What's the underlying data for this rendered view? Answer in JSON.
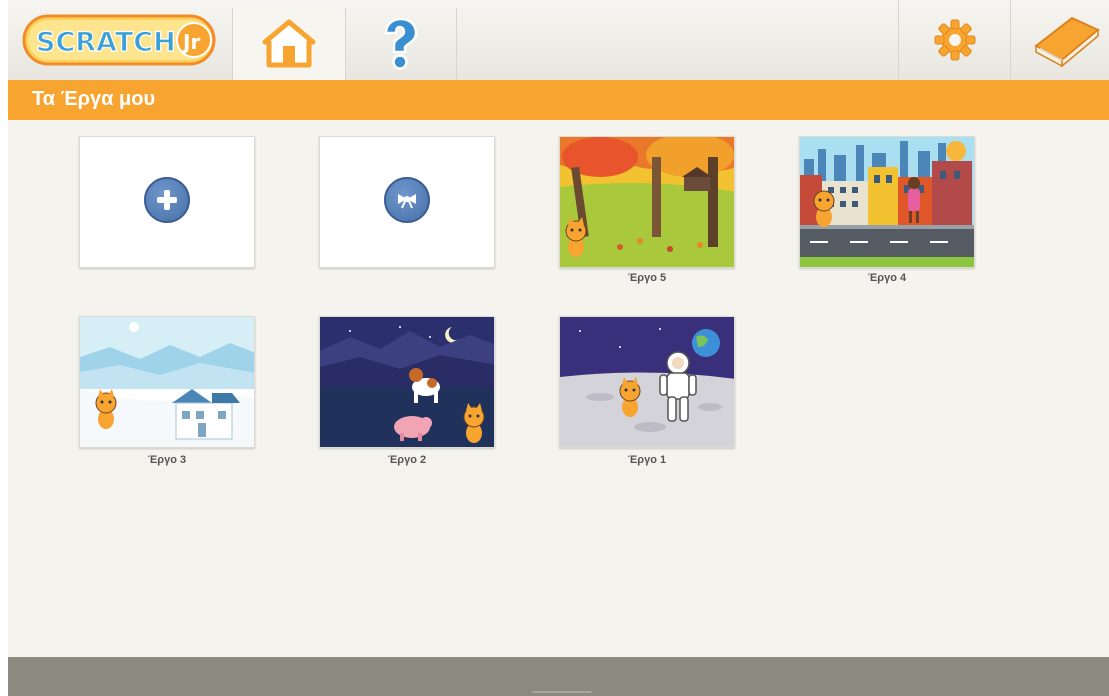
{
  "app": {
    "logo_text": "ScratchJr",
    "header_title": "Τα Έργα μου"
  },
  "toolbar": {
    "home_icon": "house-icon",
    "help_icon": "question-icon",
    "settings_icon": "gear-icon",
    "book_icon": "book-icon"
  },
  "colors": {
    "accent_orange": "#f7a431",
    "bottom_bar": "#8c8a7e",
    "button_blue": "#4f79b3"
  },
  "actions": {
    "new_project_icon": "plus-icon",
    "sample_projects_icon": "bow-icon"
  },
  "projects": [
    {
      "name": "Έργο 5",
      "scene": "autumn-park"
    },
    {
      "name": "Έργο 4",
      "scene": "city-street"
    },
    {
      "name": "Έργο 3",
      "scene": "winter-house"
    },
    {
      "name": "Έργο 2",
      "scene": "night-farm"
    },
    {
      "name": "Έργο 1",
      "scene": "moon-astronaut"
    }
  ]
}
